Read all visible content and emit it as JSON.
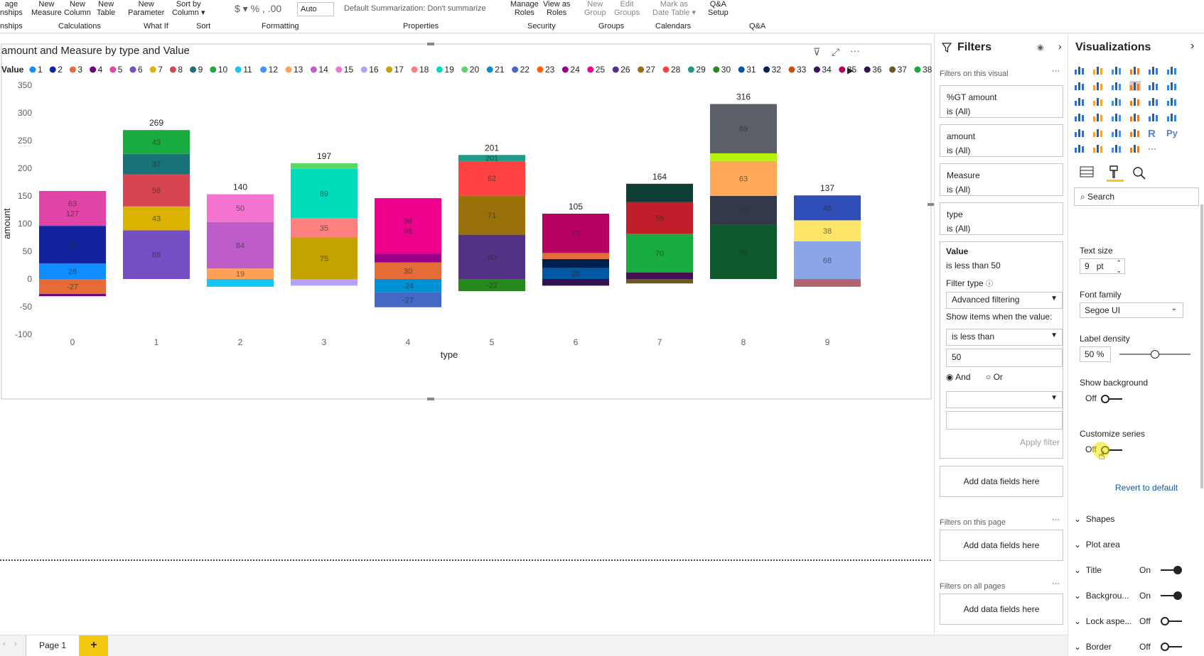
{
  "ribbon": {
    "buttons": [
      {
        "l1": "age",
        "l2": "nships"
      },
      {
        "l1": "New",
        "l2": "Measure"
      },
      {
        "l1": "New",
        "l2": "Column"
      },
      {
        "l1": "New",
        "l2": "Table"
      },
      {
        "l1": "New",
        "l2": "Parameter"
      },
      {
        "l1": "Sort by",
        "l2": "Column ▾"
      },
      {
        "l1": "Manage",
        "l2": "Roles"
      },
      {
        "l1": "View as",
        "l2": "Roles"
      },
      {
        "l1": "New",
        "l2": "Group"
      },
      {
        "l1": "Edit",
        "l2": "Groups"
      },
      {
        "l1": "Mark as",
        "l2": "Date Table ▾"
      },
      {
        "l1": "Q&A",
        "l2": "Setup"
      }
    ],
    "format_symbols": "$ ▾  %  ,  .00",
    "decimal_value": "Auto",
    "summarization": "Default Summarization: Don't summarize",
    "groups": [
      "nships",
      "Calculations",
      "What If",
      "Sort",
      "Formatting",
      "Properties",
      "Security",
      "Groups",
      "Calendars",
      "Q&A"
    ]
  },
  "chart_data": {
    "type": "bar",
    "title": "amount and Measure by type and Value",
    "xlabel": "type",
    "ylabel": "amount",
    "ylim": [
      -100,
      350
    ],
    "yticks": [
      350,
      300,
      250,
      200,
      150,
      100,
      50,
      0,
      -50,
      -100
    ],
    "categories": [
      "0",
      "1",
      "2",
      "3",
      "4",
      "5",
      "6",
      "7",
      "8",
      "9"
    ],
    "totals": [
      "",
      "269",
      "140",
      "197",
      "",
      "201",
      "105",
      "164",
      "316",
      "137"
    ],
    "legend_title": "Value",
    "legend": [
      {
        "name": "1",
        "color": "#118DFF"
      },
      {
        "name": "2",
        "color": "#12239E"
      },
      {
        "name": "3",
        "color": "#E66C37"
      },
      {
        "name": "4",
        "color": "#6B007B"
      },
      {
        "name": "5",
        "color": "#E044A7"
      },
      {
        "name": "6",
        "color": "#744EC2"
      },
      {
        "name": "7",
        "color": "#D9B300"
      },
      {
        "name": "8",
        "color": "#D64550"
      },
      {
        "name": "9",
        "color": "#197278"
      },
      {
        "name": "10",
        "color": "#1AAB40"
      },
      {
        "name": "11",
        "color": "#15C6F4"
      },
      {
        "name": "12",
        "color": "#4092FF"
      },
      {
        "name": "13",
        "color": "#FFA058"
      },
      {
        "name": "14",
        "color": "#BE5DC9"
      },
      {
        "name": "15",
        "color": "#F472D0"
      },
      {
        "name": "16",
        "color": "#B5A1FF"
      },
      {
        "name": "17",
        "color": "#C4A200"
      },
      {
        "name": "18",
        "color": "#FF8080"
      },
      {
        "name": "19",
        "color": "#00DBBC"
      },
      {
        "name": "20",
        "color": "#5BD667"
      },
      {
        "name": "21",
        "color": "#0091D5"
      },
      {
        "name": "22",
        "color": "#4668C5"
      },
      {
        "name": "23",
        "color": "#FF6300"
      },
      {
        "name": "24",
        "color": "#99008A"
      },
      {
        "name": "25",
        "color": "#EC008C"
      },
      {
        "name": "26",
        "color": "#533285"
      },
      {
        "name": "27",
        "color": "#99700A"
      },
      {
        "name": "28",
        "color": "#FF4141"
      },
      {
        "name": "29",
        "color": "#1F9A85"
      },
      {
        "name": "30",
        "color": "#25891C"
      },
      {
        "name": "31",
        "color": "#0057A2"
      },
      {
        "name": "32",
        "color": "#002050"
      },
      {
        "name": "33",
        "color": "#C94F0F"
      },
      {
        "name": "34",
        "color": "#450F54"
      },
      {
        "name": "35",
        "color": "#B60064"
      },
      {
        "name": "36",
        "color": "#34124F"
      },
      {
        "name": "37",
        "color": "#6A5A29"
      },
      {
        "name": "38",
        "color": "#1AAB40"
      }
    ],
    "stacks": [
      {
        "category": "0",
        "segments": [
          {
            "from": 0,
            "to": 28,
            "color": "#118DFF",
            "label": "28"
          },
          {
            "from": 28,
            "to": 96,
            "color": "#12239E",
            "label": "68"
          },
          {
            "from": 96,
            "to": 159,
            "color": "#E044A7",
            "label": "63\n127"
          },
          {
            "from": -27,
            "to": 0,
            "color": "#E66C37",
            "label": "-27"
          },
          {
            "from": -31,
            "to": -27,
            "color": "#6B007B",
            "label": ""
          }
        ]
      },
      {
        "category": "1",
        "segments": [
          {
            "from": 0,
            "to": 88,
            "color": "#744EC2",
            "label": "88"
          },
          {
            "from": 88,
            "to": 131,
            "color": "#D9B300",
            "label": "43"
          },
          {
            "from": 131,
            "to": 189,
            "color": "#D64550",
            "label": "58"
          },
          {
            "from": 189,
            "to": 226,
            "color": "#197278",
            "label": "37"
          },
          {
            "from": 226,
            "to": 269,
            "color": "#1AAB40",
            "label": "43"
          }
        ]
      },
      {
        "category": "2",
        "segments": [
          {
            "from": 0,
            "to": 19,
            "color": "#FFA058",
            "label": "19"
          },
          {
            "from": 19,
            "to": 103,
            "color": "#BE5DC9",
            "label": "84"
          },
          {
            "from": 103,
            "to": 153,
            "color": "#F472D0",
            "label": "50"
          },
          {
            "from": -14,
            "to": 0,
            "color": "#15C6F4",
            "label": ""
          }
        ]
      },
      {
        "category": "3",
        "segments": [
          {
            "from": 0,
            "to": 75,
            "color": "#C4A200",
            "label": "75"
          },
          {
            "from": 75,
            "to": 110,
            "color": "#FF8080",
            "label": "35"
          },
          {
            "from": 110,
            "to": 199,
            "color": "#00DBBC",
            "label": "89"
          },
          {
            "from": 199,
            "to": 209,
            "color": "#5BD667",
            "label": ""
          },
          {
            "from": -12,
            "to": 0,
            "color": "#B5A1FF",
            "label": ""
          }
        ]
      },
      {
        "category": "4",
        "segments": [
          {
            "from": 0,
            "to": 30,
            "color": "#E66C37",
            "label": "30"
          },
          {
            "from": 30,
            "to": 46,
            "color": "#99008A",
            "label": ""
          },
          {
            "from": 46,
            "to": 146,
            "color": "#EC008C",
            "label": "96\n96"
          },
          {
            "from": -24,
            "to": 0,
            "color": "#0091D5",
            "label": "-24"
          },
          {
            "from": -51,
            "to": -24,
            "color": "#4668C5",
            "label": "-27"
          }
        ]
      },
      {
        "category": "5",
        "segments": [
          {
            "from": 0,
            "to": 80,
            "color": "#533285",
            "label": "80"
          },
          {
            "from": 80,
            "to": 151,
            "color": "#99700A",
            "label": "71"
          },
          {
            "from": 151,
            "to": 213,
            "color": "#FF4141",
            "label": "62"
          },
          {
            "from": 213,
            "to": 224,
            "color": "#1F9A85",
            "label": "201"
          },
          {
            "from": -22,
            "to": 0,
            "color": "#25891C",
            "label": "-22"
          }
        ]
      },
      {
        "category": "6",
        "segments": [
          {
            "from": 0,
            "to": 20,
            "color": "#0057A2",
            "label": "20"
          },
          {
            "from": 20,
            "to": 36,
            "color": "#002050",
            "label": ""
          },
          {
            "from": 36,
            "to": 47,
            "color": "#E66C37",
            "label": ""
          },
          {
            "from": 47,
            "to": 118,
            "color": "#B60064",
            "label": "70"
          },
          {
            "from": -12,
            "to": 0,
            "color": "#34124F",
            "label": ""
          }
        ]
      },
      {
        "category": "7",
        "segments": [
          {
            "from": 0,
            "to": 12,
            "color": "#450F54",
            "label": ""
          },
          {
            "from": 12,
            "to": 82,
            "color": "#1AAB40",
            "label": "70"
          },
          {
            "from": 82,
            "to": 139,
            "color": "#C01E2A",
            "label": "56"
          },
          {
            "from": 139,
            "to": 172,
            "color": "#0E3F37",
            "label": "33"
          },
          {
            "from": -8,
            "to": 0,
            "color": "#6A5A29",
            "label": ""
          }
        ]
      },
      {
        "category": "8",
        "segments": [
          {
            "from": 0,
            "to": 98,
            "color": "#0E5A2C",
            "label": "98"
          },
          {
            "from": 98,
            "to": 150,
            "color": "#323A4A",
            "label": "52"
          },
          {
            "from": 150,
            "to": 213,
            "color": "#FFA958",
            "label": "63"
          },
          {
            "from": 213,
            "to": 227,
            "color": "#B7F20A",
            "label": ""
          },
          {
            "from": 227,
            "to": 316,
            "color": "#5C6068",
            "label": "89"
          }
        ]
      },
      {
        "category": "9",
        "segments": [
          {
            "from": 0,
            "to": 68,
            "color": "#8CA4E8",
            "label": "68"
          },
          {
            "from": 68,
            "to": 106,
            "color": "#FBE466",
            "label": "38"
          },
          {
            "from": 106,
            "to": 151,
            "color": "#2F4EB8",
            "label": "45"
          },
          {
            "from": -14,
            "to": 0,
            "color": "#B2646F",
            "label": ""
          }
        ]
      }
    ]
  },
  "filters": {
    "title": "Filters",
    "on_visual": "Filters on this visual",
    "more": "···",
    "cards": [
      {
        "field": "%GT amount",
        "state": "is (All)"
      },
      {
        "field": "amount",
        "state": "is (All)"
      },
      {
        "field": "Measure",
        "state": "is (All)"
      },
      {
        "field": "type",
        "state": "is (All)"
      }
    ],
    "active": {
      "field": "Value",
      "state": "is less than 50",
      "type_label": "Filter type",
      "type_value": "Advanced filtering",
      "show_label": "Show items when the value:",
      "condition": "is less than",
      "value": "50",
      "and": "And",
      "or": "Or",
      "apply": "Apply filter"
    },
    "add_fields": "Add data fields here",
    "on_page": "Filters on this page",
    "on_all": "Filters on all pages"
  },
  "viz": {
    "title": "Visualizations",
    "search_placeholder": "Search",
    "text_size_label": "Text size",
    "text_size": "9",
    "text_size_unit": "pt",
    "font_family_label": "Font family",
    "font_family": "Segoe UI",
    "label_density_label": "Label density",
    "label_density": "50",
    "label_density_unit": "%",
    "show_bg_label": "Show background",
    "show_bg": "Off",
    "customize_label": "Customize series",
    "customize": "Off",
    "revert": "Revert to default",
    "sections": [
      {
        "name": "Shapes",
        "state": ""
      },
      {
        "name": "Plot area",
        "state": ""
      },
      {
        "name": "Title",
        "state": "On"
      },
      {
        "name": "Backgrou...",
        "state": "On"
      },
      {
        "name": "Lock aspe...",
        "state": "Off"
      },
      {
        "name": "Border",
        "state": "Off"
      }
    ]
  },
  "tabs": {
    "page": "Page 1",
    "add": "+"
  }
}
